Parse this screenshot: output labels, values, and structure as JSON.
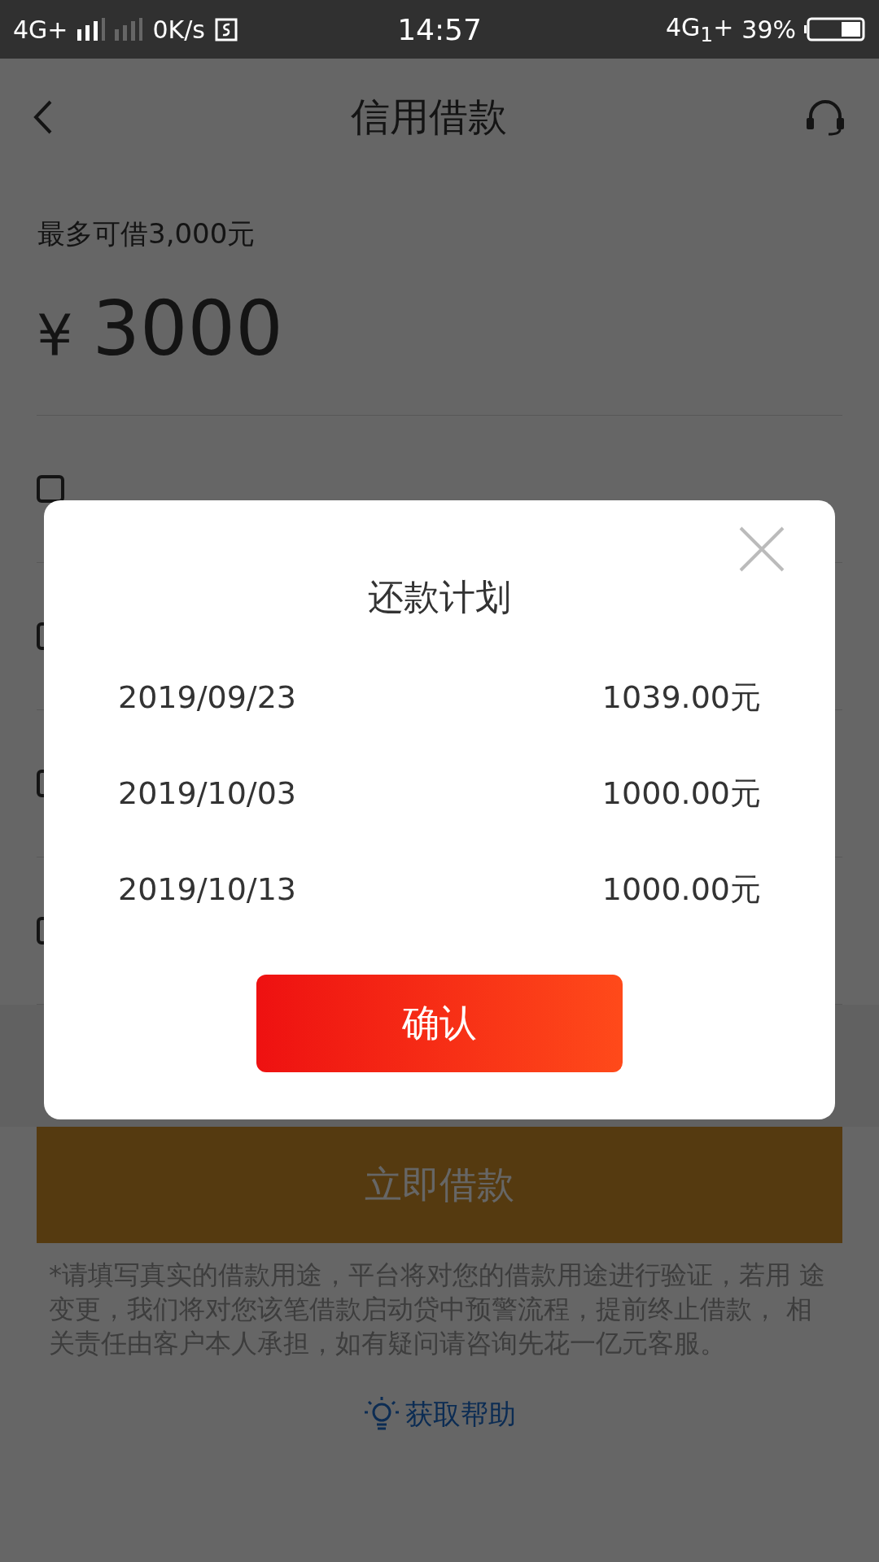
{
  "status_bar": {
    "network": "4G+",
    "speed": "0K/s",
    "time": "14:57",
    "network_2": "4G$_{1}$+",
    "battery": "39%"
  },
  "header": {
    "title": "信用借款"
  },
  "limit": "最多可借3,000元",
  "amount": {
    "currency": "¥",
    "value": "3000"
  },
  "submit_button": "立即借款",
  "notice": "*请填写真实的借款用途，平台将对您的借款用途进行验证，若用 途变更，我们将对您该笔借款启动贷中预警流程，提前终止借款， 相关责任由客户本人承担，如有疑问请咨询先花一亿元客服。",
  "help_link": "获取帮助",
  "dialog": {
    "title": "还款计划",
    "schedule": [
      {
        "date": "2019/09/23",
        "amount": "1039.00元"
      },
      {
        "date": "2019/10/03",
        "amount": "1000.00元"
      },
      {
        "date": "2019/10/13",
        "amount": "1000.00元"
      }
    ],
    "confirm_button": "确认"
  }
}
